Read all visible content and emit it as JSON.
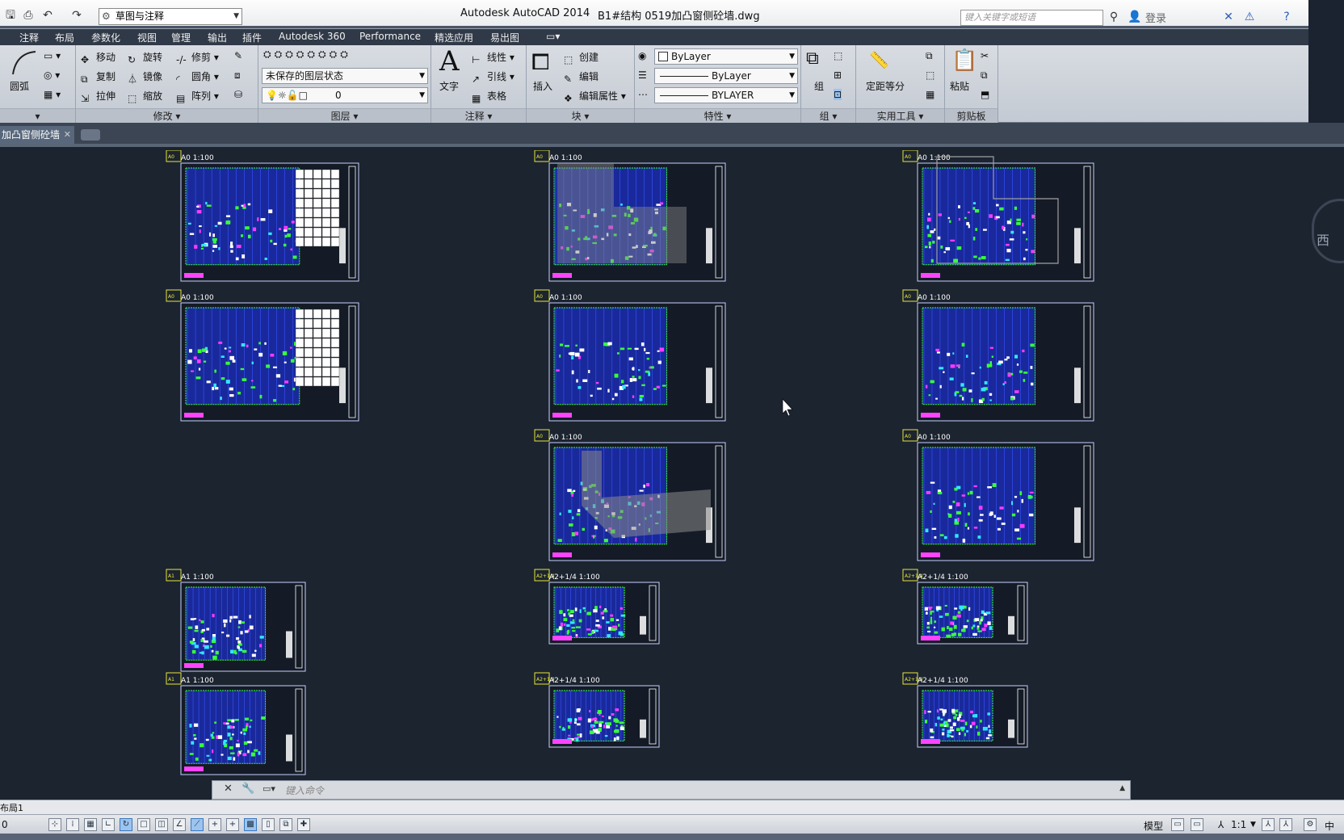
{
  "window": {
    "app_title": "Autodesk AutoCAD 2014",
    "file_title": "B1#结构 0519加凸窗侧砼墙.dwg",
    "workspace": "草图与注释",
    "search_placeholder": "键入关键字或短语",
    "login": "登录"
  },
  "menu": [
    "注释",
    "布局",
    "参数化",
    "视图",
    "管理",
    "输出",
    "插件",
    "Autodesk 360",
    "Performance",
    "精选应用",
    "易出图"
  ],
  "ribbon": {
    "draw": {
      "arc": "圆弧"
    },
    "modify": {
      "title": "修改",
      "move": "移动",
      "rotate": "旋转",
      "trim": "修剪",
      "copy": "复制",
      "mirror": "镜像",
      "fillet": "圆角",
      "stretch": "拉伸",
      "scale": "缩放",
      "array": "阵列"
    },
    "layers": {
      "title": "图层",
      "state": "未保存的图层状态",
      "current": "0"
    },
    "annotation": {
      "title": "注释",
      "text": "文字",
      "linear": "线性",
      "leader": "引线",
      "table": "表格"
    },
    "block": {
      "title": "块",
      "insert": "插入",
      "create": "创建",
      "edit": "编辑",
      "edit_attr": "编辑属性"
    },
    "properties": {
      "title": "特性",
      "color": "ByLayer",
      "linetype": "ByLayer",
      "lineweight": "BYLAYER"
    },
    "group": {
      "title": "组",
      "group": "组"
    },
    "utilities": {
      "title": "实用工具",
      "measure": "定距等分"
    },
    "clipboard": {
      "title": "剪贴板",
      "paste": "粘贴"
    }
  },
  "doc_tab": "加凸窗侧砼墙",
  "sheets": [
    {
      "label": "A0 1:100",
      "tag": "A0"
    },
    {
      "label": "A0 1:100",
      "tag": "A0"
    },
    {
      "label": "A0 1:100",
      "tag": "A0"
    },
    {
      "label": "A0 1:100",
      "tag": "A0"
    },
    {
      "label": "A0 1:100",
      "tag": "A0"
    },
    {
      "label": "A0 1:100",
      "tag": "A0"
    },
    {
      "label": "A0 1:100",
      "tag": "A0"
    },
    {
      "label": "A0 1:100",
      "tag": "A0"
    },
    {
      "label": "A1 1:100",
      "tag": "A1"
    },
    {
      "label": "A1 1:100",
      "tag": "A1"
    },
    {
      "label": "A2+1/4 1:100",
      "tag": "A2+1/4"
    },
    {
      "label": "A2+1/4 1:100",
      "tag": "A2+1/4"
    },
    {
      "label": "A2+1/4 1:100",
      "tag": "A2+1/4"
    },
    {
      "label": "A2+1/4 1:100",
      "tag": "A2+1/4"
    }
  ],
  "viewcube_label": "西",
  "command": {
    "placeholder": "键入命令"
  },
  "layout_tab": "布局1",
  "status": {
    "model": "模型",
    "scale": "1:1",
    "ime": "中"
  }
}
